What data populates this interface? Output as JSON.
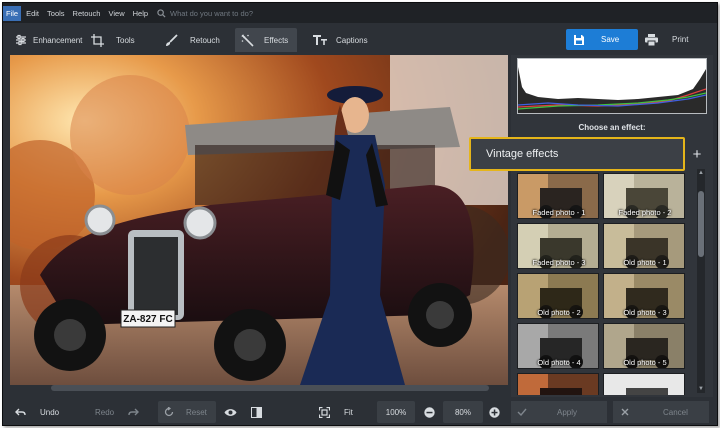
{
  "menu": {
    "items": [
      "File",
      "Edit",
      "Tools",
      "Retouch",
      "View",
      "Help"
    ],
    "search_placeholder": "What do you want to do?"
  },
  "tabs": [
    {
      "label": "Enhancement",
      "icon": "sliders-icon"
    },
    {
      "label": "Tools",
      "icon": "crop-icon"
    },
    {
      "label": "Retouch",
      "icon": "brush-icon"
    },
    {
      "label": "Effects",
      "icon": "magic-wand-icon",
      "active": true
    },
    {
      "label": "Captions",
      "icon": "text-icon"
    }
  ],
  "actions": {
    "save": "Save",
    "print": "Print"
  },
  "photo": {
    "plate": "ZA-827 FC"
  },
  "panel": {
    "title": "Choose an effect:",
    "category": "Vintage effects",
    "add_label": "+",
    "effects": [
      {
        "label": "Faded photo - 1"
      },
      {
        "label": "Faded photo - 2"
      },
      {
        "label": "Faded photo - 3"
      },
      {
        "label": "Old photo - 1"
      },
      {
        "label": "Old photo - 2"
      },
      {
        "label": "Old photo - 3"
      },
      {
        "label": "Old photo - 4"
      },
      {
        "label": "Old photo - 5"
      },
      {
        "label": ""
      },
      {
        "label": ""
      }
    ]
  },
  "bottom": {
    "undo": "Undo",
    "redo": "Redo",
    "reset": "Reset",
    "fit": "Fit",
    "zoom_100": "100%",
    "zoom_level": "80%",
    "apply": "Apply",
    "cancel": "Cancel"
  },
  "colors": {
    "accent": "#1d7dd6",
    "highlight": "#e5b51a",
    "menu_active": "#3a6fb5"
  }
}
